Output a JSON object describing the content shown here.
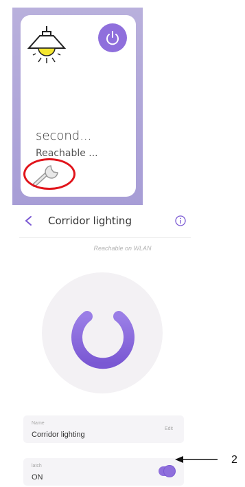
{
  "device_card": {
    "name": "second...",
    "status": "Reachable ..."
  },
  "header": {
    "title": "Corridor lighting"
  },
  "connection_status": "Reachable on WLAN",
  "fields": {
    "name": {
      "label": "Name",
      "value": "Corridor lighting",
      "edit_label": "Edit"
    },
    "latch": {
      "label": "latch",
      "value": "ON",
      "toggle_on": true
    }
  },
  "callout_number": "2",
  "colors": {
    "accent": "#8f6fdc",
    "highlight": "#e1141b"
  },
  "icons": [
    "lamp-icon",
    "power-icon",
    "wrench-icon",
    "back-arrow-icon",
    "info-icon"
  ]
}
